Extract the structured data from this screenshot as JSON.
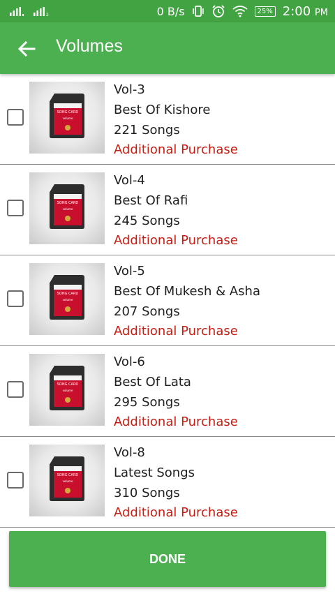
{
  "statusbar": {
    "net_speed": "0 B/s",
    "battery": "25%",
    "time": "2:00",
    "ampm": "PM"
  },
  "appbar": {
    "title": "Volumes"
  },
  "items": [
    {
      "vol": "Vol-3",
      "title": "Best Of Kishore",
      "songs": "221 Songs",
      "note": "Additional Purchase",
      "checked": false
    },
    {
      "vol": "Vol-4",
      "title": "Best Of Rafi",
      "songs": "245 Songs",
      "note": "Additional Purchase",
      "checked": false
    },
    {
      "vol": "Vol-5",
      "title": "Best Of Mukesh & Asha",
      "songs": "207 Songs",
      "note": "Additional Purchase",
      "checked": false
    },
    {
      "vol": "Vol-6",
      "title": "Best Of Lata",
      "songs": "295 Songs",
      "note": "Additional Purchase",
      "checked": false
    },
    {
      "vol": "Vol-8",
      "title": "Latest Songs",
      "songs": "310 Songs",
      "note": "Additional Purchase",
      "checked": false
    }
  ],
  "card_art": {
    "label": "SONG CARD",
    "sublabel": "volume"
  },
  "done_label": "DONE",
  "colors": {
    "primary": "#4caf50",
    "statusbar": "#42a343",
    "purchase": "#c81d12"
  }
}
